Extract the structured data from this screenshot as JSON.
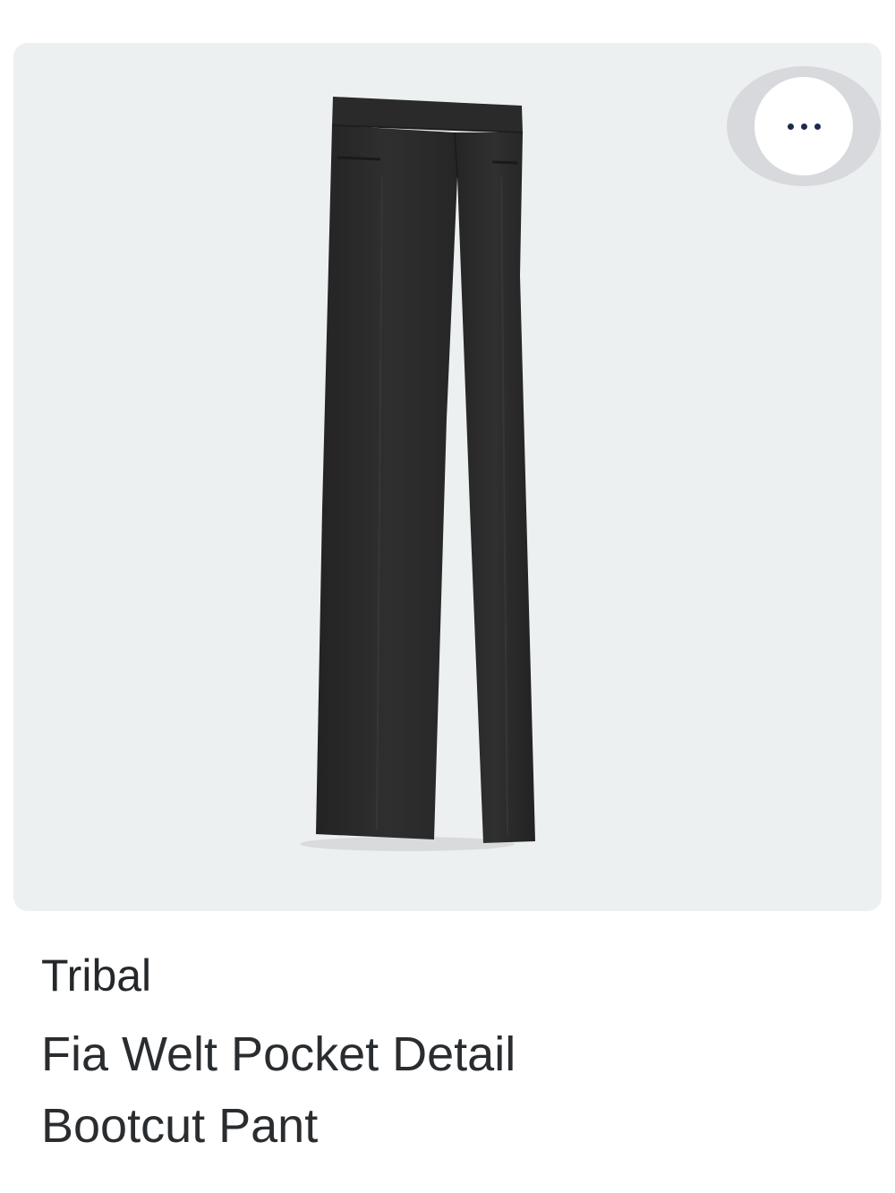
{
  "product": {
    "brand": "Tribal",
    "name_line1": "Fia Welt Pocket Detail",
    "name_line2": "Bootcut Pant",
    "image_alt": "black-bootcut-pants"
  },
  "actions": {
    "more_icon": "more-horizontal-icon"
  },
  "colors": {
    "card_background": "#edf0f1",
    "more_button_ring": "#d7d9dd",
    "more_dots": "#1c2a4d",
    "garment": "#2b2b2c"
  }
}
